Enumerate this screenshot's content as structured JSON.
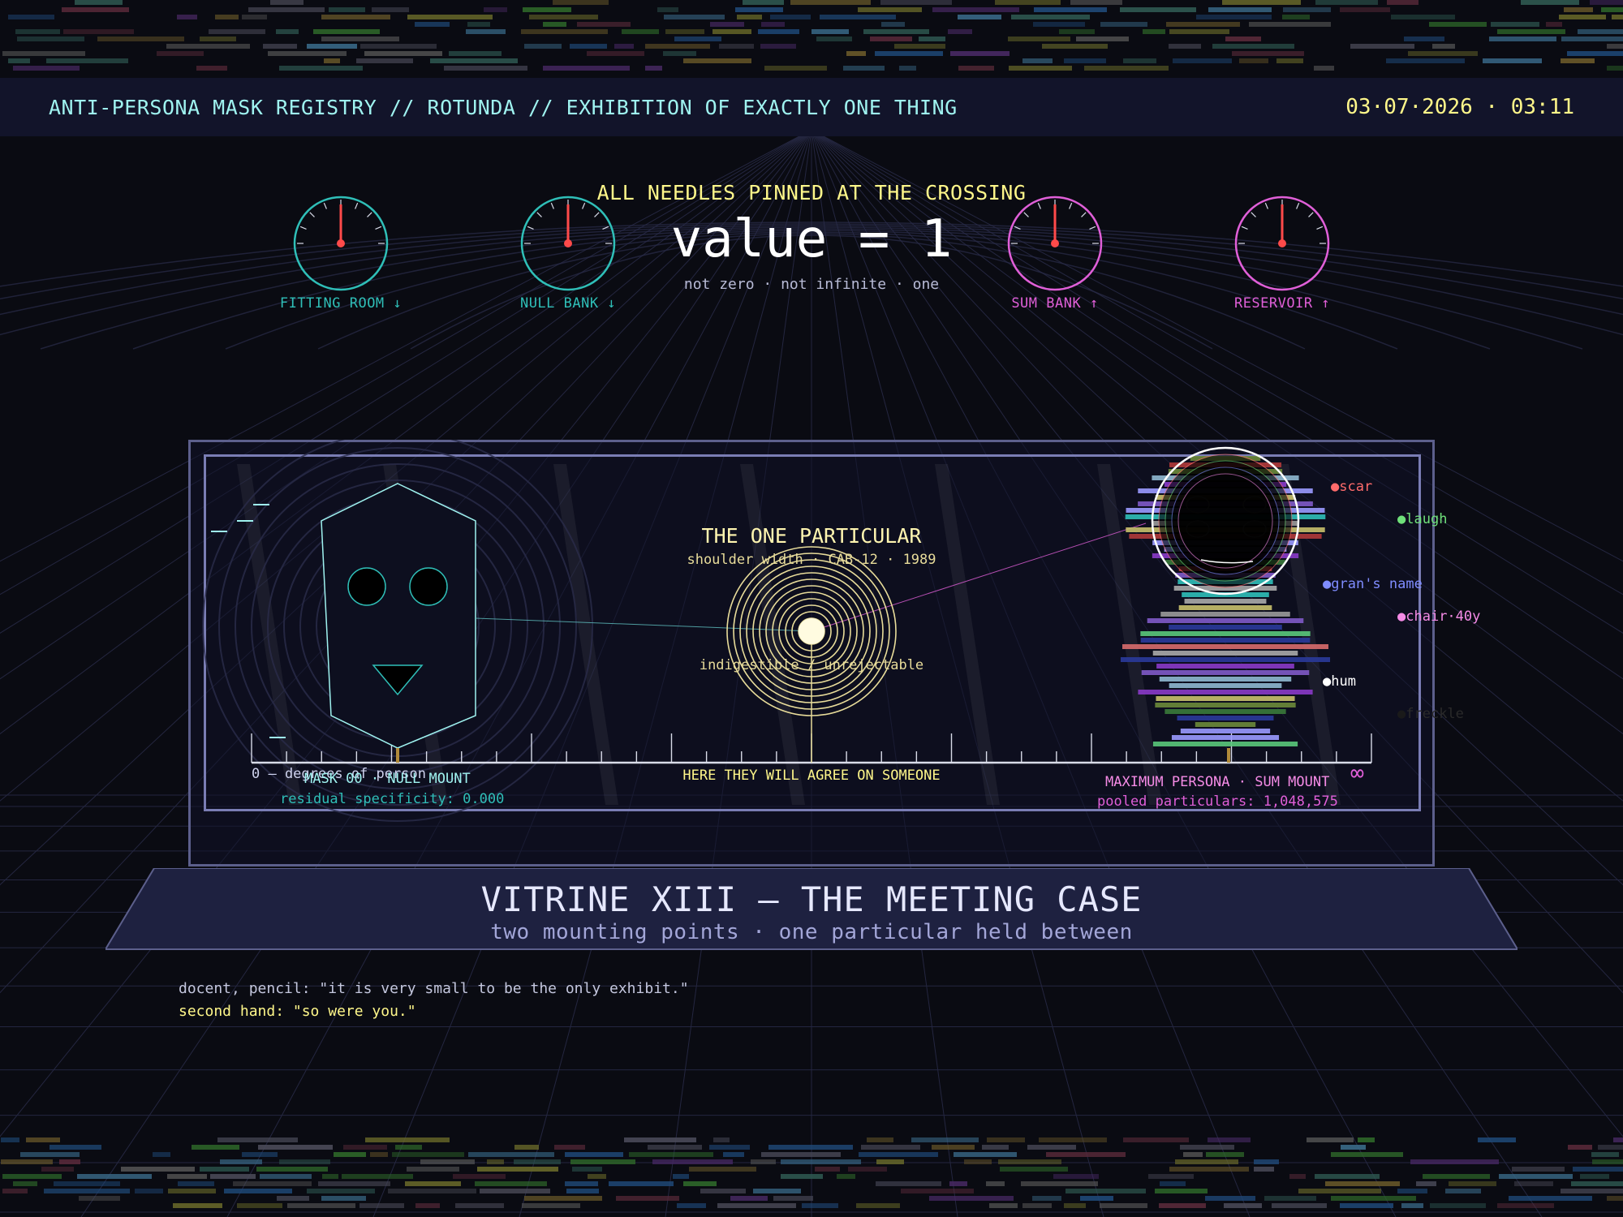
{
  "header": {
    "title": "ANTI-PERSONA MASK REGISTRY // ROTUNDA // EXHIBITION OF EXACTLY ONE THING",
    "clock": "03·07·2026 · 03:11"
  },
  "gauges": [
    {
      "label": "FITTING ROOM ↓",
      "color": "#2fbfb8",
      "needle_deg": 0
    },
    {
      "label": "NULL BANK ↓",
      "color": "#2fbfb8",
      "needle_deg": 0
    },
    {
      "label": "SUM BANK ↑",
      "color": "#e05fd8",
      "needle_deg": 0
    },
    {
      "label": "RESERVOIR ↑",
      "color": "#e05fd8",
      "needle_deg": 0
    }
  ],
  "readout": {
    "title": "ALL NEEDLES PINNED AT THE CROSSING",
    "value": "value = 1",
    "sub": "not zero · not infinite · one"
  },
  "case": {
    "particular_title": "THE ONE PARTICULAR",
    "particular_sub": "shoulder width · CAB-12 · 1989",
    "particular_note": "indigestible / unrejectable",
    "center_label": "HERE THEY WILL AGREE ON SOMEONE",
    "axis_start": "0 — degrees of person",
    "axis_end": "∞",
    "left_mask": {
      "label": "MASK 00 · NULL MOUNT",
      "detail": "residual specificity: 0.000"
    },
    "right_mask": {
      "label": "MAXIMUM PERSONA · SUM MOUNT",
      "detail": "pooled particulars: 1,048,575"
    },
    "particulars": [
      {
        "label": "scar",
        "color": "#ff6b6b"
      },
      {
        "label": "laugh",
        "color": "#6fe07a"
      },
      {
        "label": "gran's name",
        "color": "#7f8cff"
      },
      {
        "label": "chair·40y",
        "color": "#f58be6"
      },
      {
        "label": "hum",
        "color": "#ffffff"
      },
      {
        "label": "freckle",
        "color": "#1a1a1a"
      }
    ]
  },
  "plinth": {
    "title": "VITRINE XIII — THE MEETING CASE",
    "sub": "two mounting points · one particular held between"
  },
  "notes": [
    "docent, pencil: \"it is very small to be the only exhibit.\"",
    "second hand: \"so were you.\""
  ]
}
